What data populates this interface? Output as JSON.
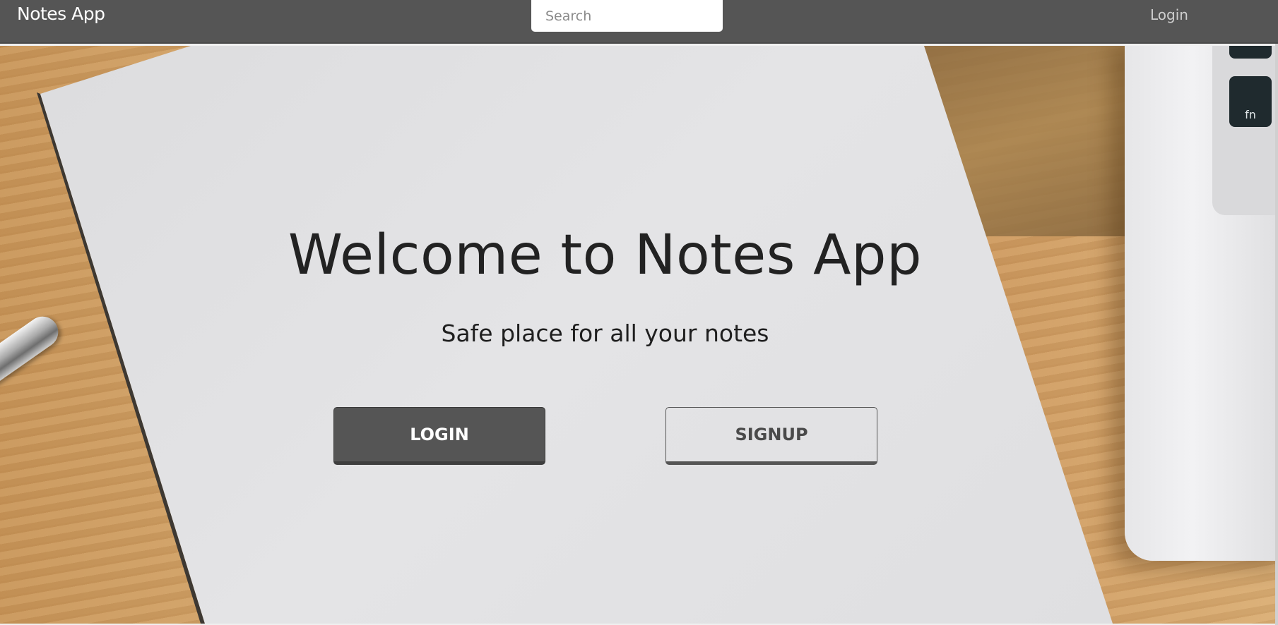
{
  "navbar": {
    "brand": "Notes App",
    "search_placeholder": "Search",
    "login_link": "Login"
  },
  "hero": {
    "title": "Welcome to Notes App",
    "subtitle": "Safe place for all your notes",
    "login_button": "LOGIN",
    "signup_button": "SIGNUP",
    "laptop_key_label": "fn"
  },
  "colors": {
    "navbar_bg": "#555555",
    "primary_button": "#555555",
    "text_dark": "#222222"
  }
}
